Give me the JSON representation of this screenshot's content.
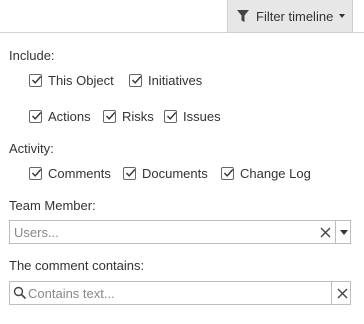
{
  "header": {
    "filter_button_label": "Filter timeline"
  },
  "include": {
    "label": "Include:",
    "options": [
      {
        "label": "This Object",
        "checked": true
      },
      {
        "label": "Initiatives",
        "checked": true
      },
      {
        "label": "Actions",
        "checked": true
      },
      {
        "label": "Risks",
        "checked": true
      },
      {
        "label": "Issues",
        "checked": true
      }
    ]
  },
  "activity": {
    "label": "Activity:",
    "options": [
      {
        "label": "Comments",
        "checked": true
      },
      {
        "label": "Documents",
        "checked": true
      },
      {
        "label": "Change Log",
        "checked": true
      }
    ]
  },
  "team_member": {
    "label": "Team Member:",
    "placeholder": "Users...",
    "value": ""
  },
  "comment_filter": {
    "label": "The comment contains:",
    "placeholder": "Contains text...",
    "value": ""
  },
  "icons": {
    "filter": "funnel-icon",
    "checkbox": "checkmark-icon",
    "clear": "close-icon",
    "dropdown": "caret-down-icon",
    "search": "search-icon"
  }
}
